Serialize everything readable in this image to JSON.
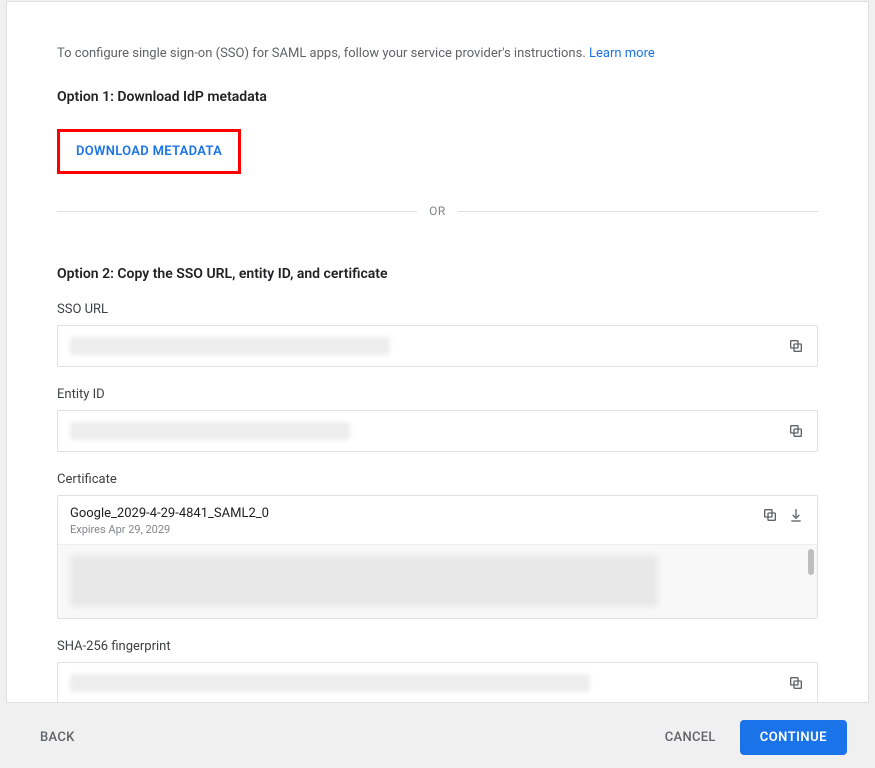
{
  "intro": {
    "text": "To configure single sign-on (SSO) for SAML apps, follow your service provider's instructions. ",
    "learn_more": "Learn more"
  },
  "option1": {
    "heading": "Option 1: Download IdP metadata",
    "download_label": "DOWNLOAD METADATA"
  },
  "divider": {
    "or": "OR"
  },
  "option2": {
    "heading": "Option 2: Copy the SSO URL, entity ID, and certificate",
    "sso_url_label": "SSO URL",
    "entity_id_label": "Entity ID",
    "certificate_label": "Certificate",
    "certificate_name": "Google_2029-4-29-4841_SAML2_0",
    "certificate_expires": "Expires Apr 29, 2029",
    "sha_label": "SHA-256 fingerprint"
  },
  "footer": {
    "back": "BACK",
    "cancel": "CANCEL",
    "continue": "CONTINUE"
  }
}
